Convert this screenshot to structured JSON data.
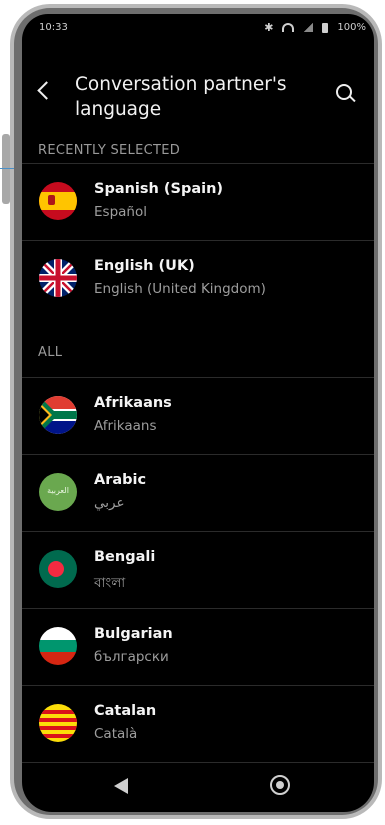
{
  "status_bar": {
    "time": "10:33",
    "battery": "100%"
  },
  "header": {
    "title": "Conversation partner's language"
  },
  "sections": {
    "recent": "RECENTLY SELECTED",
    "all": "ALL"
  },
  "recent": [
    {
      "name": "Spanish (Spain)",
      "native": "Español",
      "icon": "spain-flag-icon"
    },
    {
      "name": "English (UK)",
      "native": "English (United Kingdom)",
      "icon": "uk-flag-icon"
    }
  ],
  "all": [
    {
      "name": "Afrikaans",
      "native": "Afrikaans",
      "icon": "south-africa-flag-icon"
    },
    {
      "name": "Arabic",
      "native": "عربي",
      "icon": "arabic-flag-icon",
      "flag_text": "العربية"
    },
    {
      "name": "Bengali",
      "native": "বাংলা",
      "icon": "bangladesh-flag-icon"
    },
    {
      "name": "Bulgarian",
      "native": "български",
      "icon": "bulgaria-flag-icon"
    },
    {
      "name": "Catalan",
      "native": "Català",
      "icon": "catalonia-flag-icon"
    }
  ],
  "colors": {
    "background": "#000000",
    "secondary_text": "#9d9d9d"
  }
}
